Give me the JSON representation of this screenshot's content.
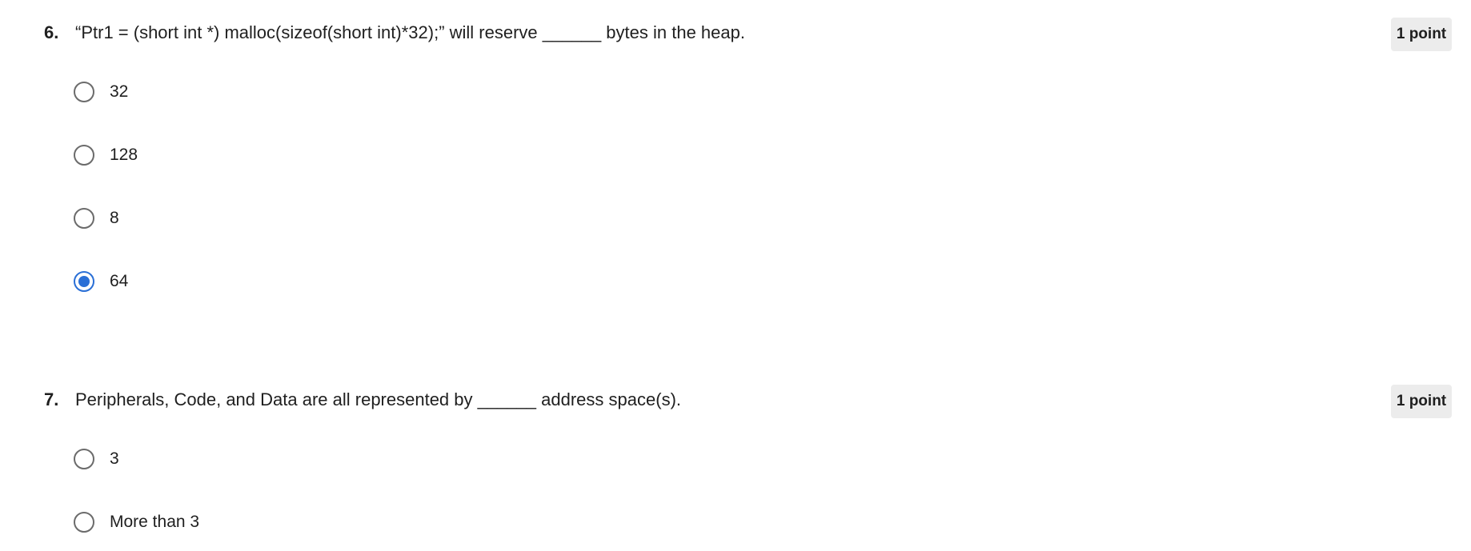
{
  "questions": [
    {
      "number": "6.",
      "text": "“Ptr1 = (short int *) malloc(sizeof(short int)*32);” will reserve ______ bytes in the heap.",
      "points": "1 point",
      "options": [
        {
          "label": "32",
          "selected": false
        },
        {
          "label": "128",
          "selected": false
        },
        {
          "label": "8",
          "selected": false
        },
        {
          "label": "64",
          "selected": true
        }
      ]
    },
    {
      "number": "7.",
      "text": "Peripherals, Code, and Data are all represented by ______ address space(s).",
      "points": "1 point",
      "options": [
        {
          "label": "3",
          "selected": false
        },
        {
          "label": "More than 3",
          "selected": false
        }
      ]
    }
  ],
  "colors": {
    "accent": "#2a6fd6",
    "radio_border": "#6b6b6b",
    "badge_bg": "#ececec"
  }
}
